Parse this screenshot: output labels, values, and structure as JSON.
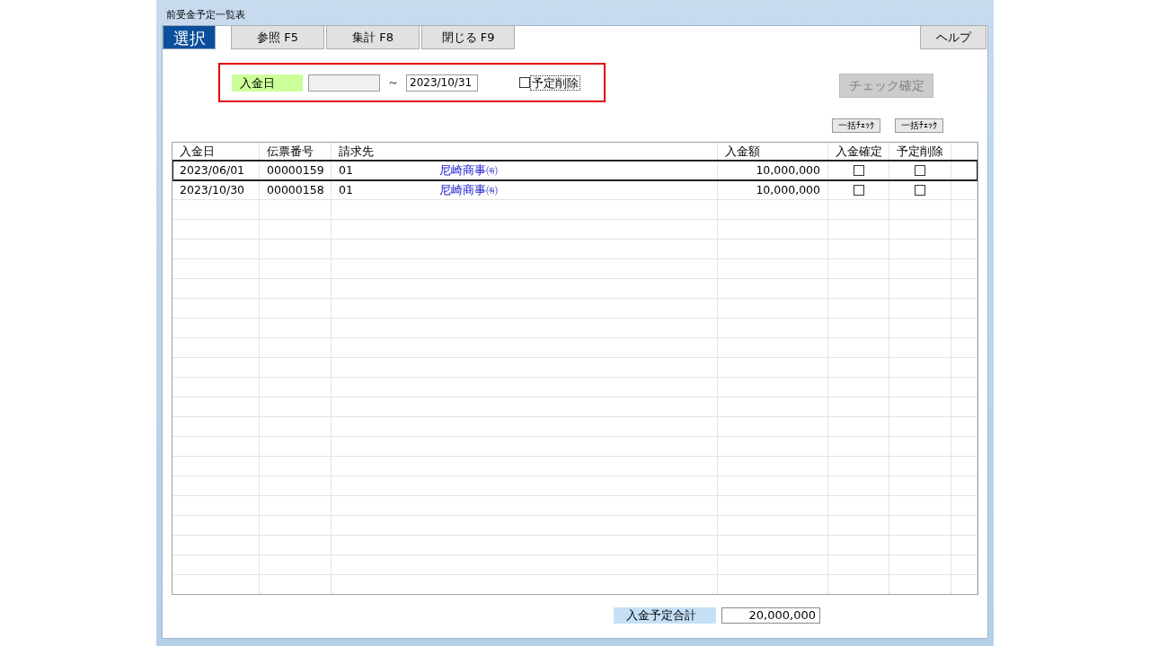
{
  "window": {
    "title": "前受金予定一覧表"
  },
  "toolbar": {
    "mode_label": "選択",
    "buttons": [
      "参照 F5",
      "集計 F8",
      "閉じる F9"
    ],
    "help_button": "ヘルプ"
  },
  "filter": {
    "label": "入金日",
    "date_to": "2023/10/31",
    "range_sign": "～",
    "delete_option": {
      "label": "予定削除",
      "checked": false
    }
  },
  "confirm_button": {
    "label": "チェック確定",
    "disabled": true
  },
  "bulk_buttons": [
    "一括ﾁｪｯｸ",
    "一括ﾁｪｯｸ"
  ],
  "table": {
    "columns": [
      "入金日",
      "伝票番号",
      "請求先",
      "入金額",
      "入金確定",
      "予定削除"
    ],
    "rows": [
      {
        "date": "2023/06/01",
        "slip_no": "00000159",
        "customer_code": "01",
        "customer_name": "尼崎商事㈲",
        "amount": "10,000,000",
        "confirmed": false,
        "delete": false,
        "selected": true
      },
      {
        "date": "2023/10/30",
        "slip_no": "00000158",
        "customer_code": "01",
        "customer_name": "尼崎商事㈲",
        "amount": "10,000,000",
        "confirmed": false,
        "delete": false,
        "selected": false
      }
    ]
  },
  "total": {
    "label": "入金予定合計",
    "value": "20,000,000"
  }
}
